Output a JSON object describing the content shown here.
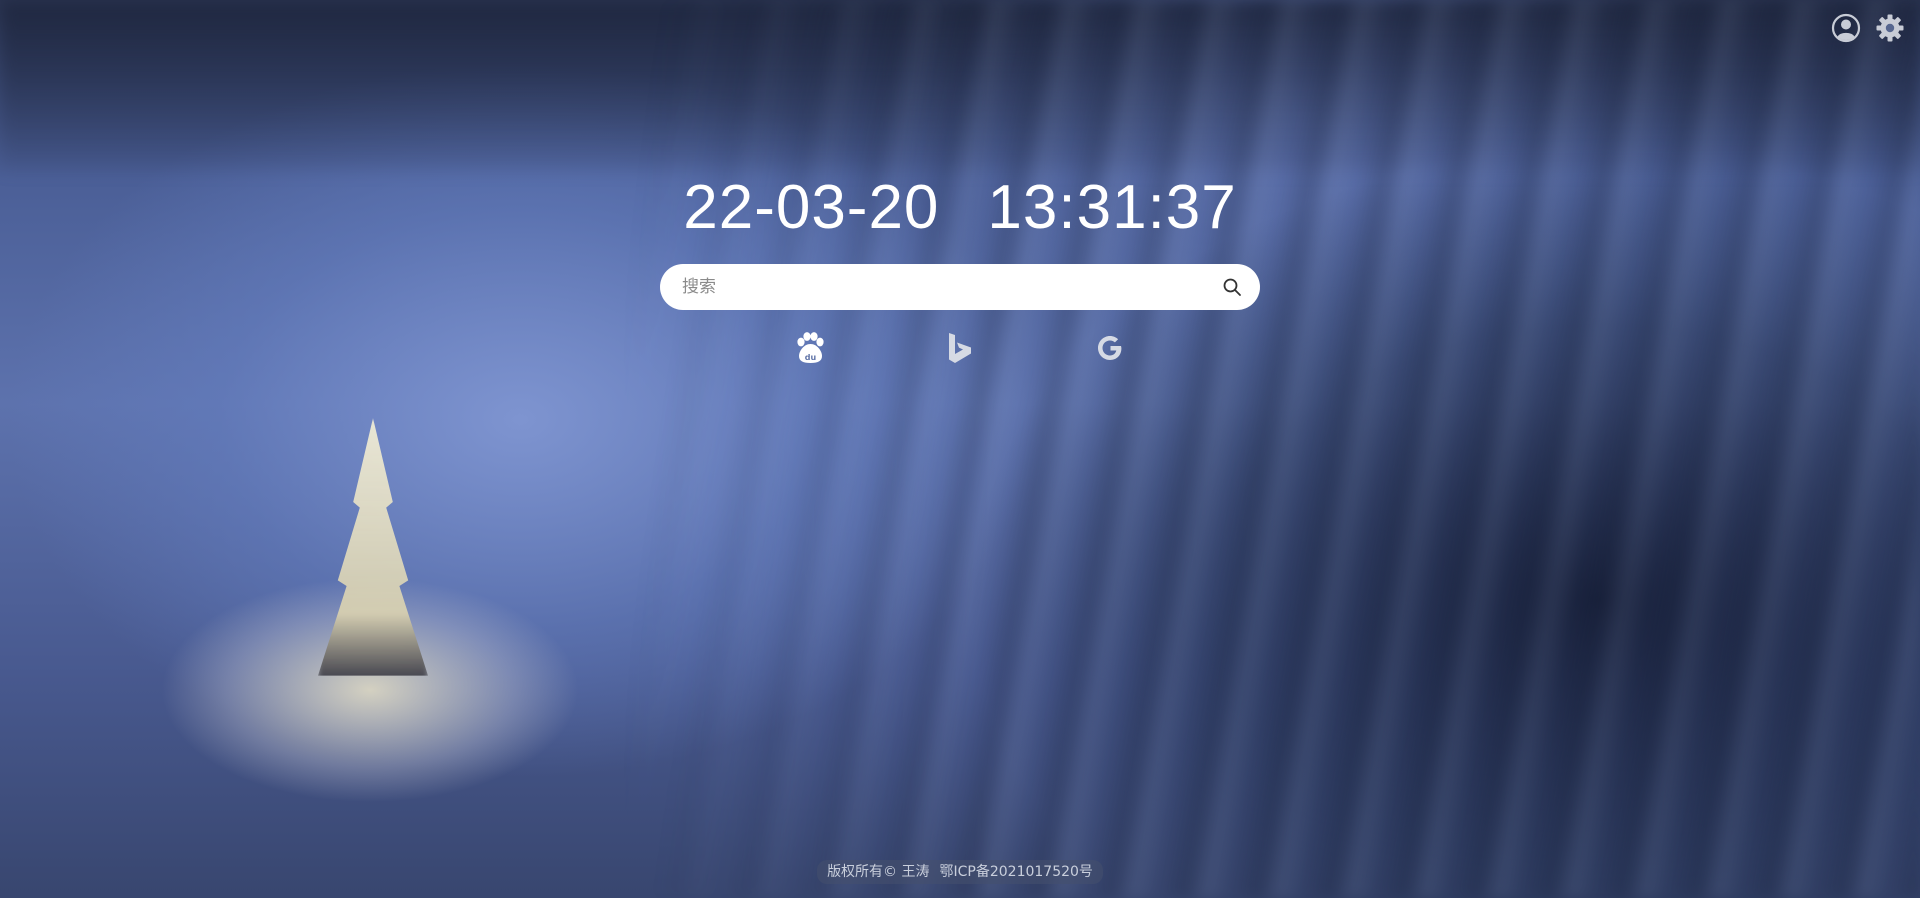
{
  "clock": {
    "date": "22-03-20",
    "time": "13:31:37"
  },
  "search": {
    "placeholder": "搜索",
    "value": "",
    "icon": "search-icon"
  },
  "header": {
    "icons": [
      "user-avatar-icon",
      "gear-icon"
    ]
  },
  "engines": [
    {
      "name": "Baidu",
      "icon": "baidu-paw-icon"
    },
    {
      "name": "Bing",
      "icon": "bing-icon"
    },
    {
      "name": "Google",
      "icon": "google-icon"
    }
  ],
  "footer": {
    "copyright": "版权所有© 王涛",
    "icp": "鄂ICP备2021017520号"
  },
  "colors": {
    "icon_gray": "#c8ccd6",
    "text_white": "#ffffff"
  }
}
